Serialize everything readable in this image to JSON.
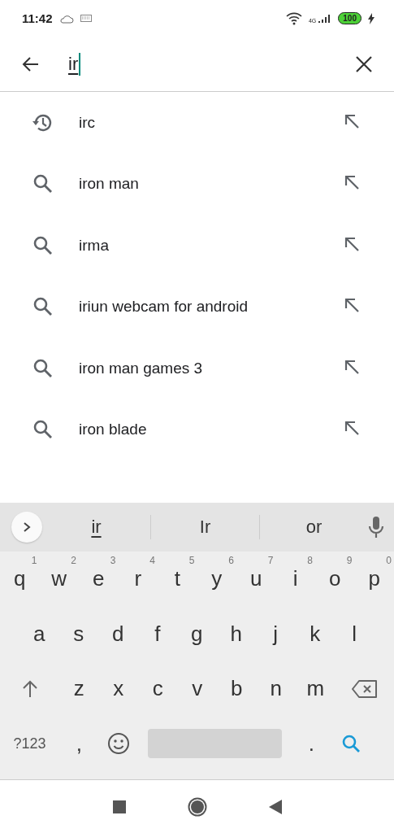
{
  "status_bar": {
    "time": "11:42",
    "network": "4G",
    "battery": "100"
  },
  "search": {
    "value": "ir"
  },
  "suggestions": [
    {
      "text": "irc",
      "kind": "history"
    },
    {
      "text": "iron man",
      "kind": "search"
    },
    {
      "text": "irma",
      "kind": "search"
    },
    {
      "text": "iriun webcam for android",
      "kind": "search"
    },
    {
      "text": "iron man games 3",
      "kind": "search"
    },
    {
      "text": "iron blade",
      "kind": "search"
    }
  ],
  "keyboard": {
    "word_suggestions": [
      {
        "text": "ir",
        "selected": true
      },
      {
        "text": "Ir",
        "selected": false
      },
      {
        "text": "or",
        "selected": false
      }
    ],
    "rows": [
      {
        "keys": [
          {
            "label": "q",
            "hint": "1"
          },
          {
            "label": "w",
            "hint": "2"
          },
          {
            "label": "e",
            "hint": "3"
          },
          {
            "label": "r",
            "hint": "4"
          },
          {
            "label": "t",
            "hint": "5"
          },
          {
            "label": "y",
            "hint": "6"
          },
          {
            "label": "u",
            "hint": "7"
          },
          {
            "label": "i",
            "hint": "8"
          },
          {
            "label": "o",
            "hint": "9"
          },
          {
            "label": "p",
            "hint": "0"
          }
        ]
      },
      {
        "keys": [
          {
            "label": "a"
          },
          {
            "label": "s"
          },
          {
            "label": "d"
          },
          {
            "label": "f"
          },
          {
            "label": "g"
          },
          {
            "label": "h"
          },
          {
            "label": "j"
          },
          {
            "label": "k"
          },
          {
            "label": "l"
          }
        ]
      },
      {
        "keys": [
          {
            "kind": "shift"
          },
          {
            "label": "z"
          },
          {
            "label": "x"
          },
          {
            "label": "c"
          },
          {
            "label": "v"
          },
          {
            "label": "b"
          },
          {
            "label": "n"
          },
          {
            "label": "m"
          },
          {
            "kind": "backspace"
          }
        ]
      },
      {
        "keys": [
          {
            "kind": "symbols",
            "label": "?123"
          },
          {
            "label": ","
          },
          {
            "kind": "emoji"
          },
          {
            "kind": "space"
          },
          {
            "label": "."
          },
          {
            "kind": "search"
          }
        ]
      }
    ]
  }
}
